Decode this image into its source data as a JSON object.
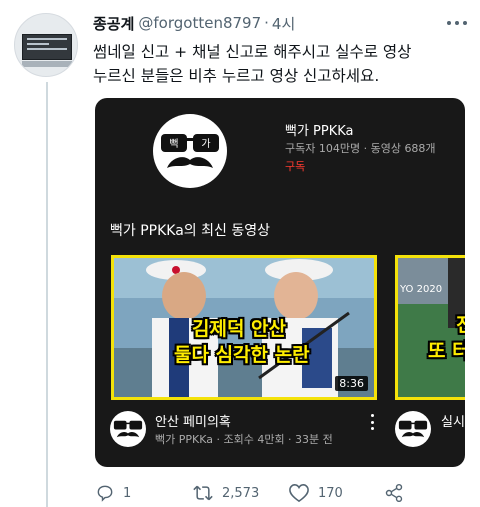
{
  "tweet": {
    "author_name": "종공계",
    "handle": "@forgotten8797",
    "separator": "·",
    "time": "4시",
    "text_lines": [
      "썸네일 신고 + 채널 신고로 해주시고 실수로 영상",
      "누르신 분들은 비추 누르고 영상 신고하세요."
    ]
  },
  "card": {
    "channel_name": "뻑가 PPKKa",
    "channel_meta": "구독자 104만명 · 동영상 688개",
    "subscribe_label": "구독",
    "section_title": "뻑가 PPKKa의 최신 동영상",
    "logo_text_left": "뻑",
    "logo_text_right": "가",
    "videos": [
      {
        "overlay_line1": "김제덕 안산",
        "overlay_line2": "둘다 심각한 논란",
        "duration": "8:36",
        "title": "안산 페미의혹",
        "meta": "뻑가 PPKKa · 조회수 4만회 · 33분 전"
      },
      {
        "overlay_year": "YO 2020",
        "overlay_line1": "진",
        "overlay_line2": "또 터",
        "title": "실시"
      }
    ]
  },
  "actions": {
    "reply_count": "1",
    "retweet_count": "2,573",
    "like_count": "170"
  },
  "colors": {
    "accent_subscribe": "#ff3b30",
    "thumbnail_border": "#f4e20a",
    "card_bg": "#181818"
  }
}
